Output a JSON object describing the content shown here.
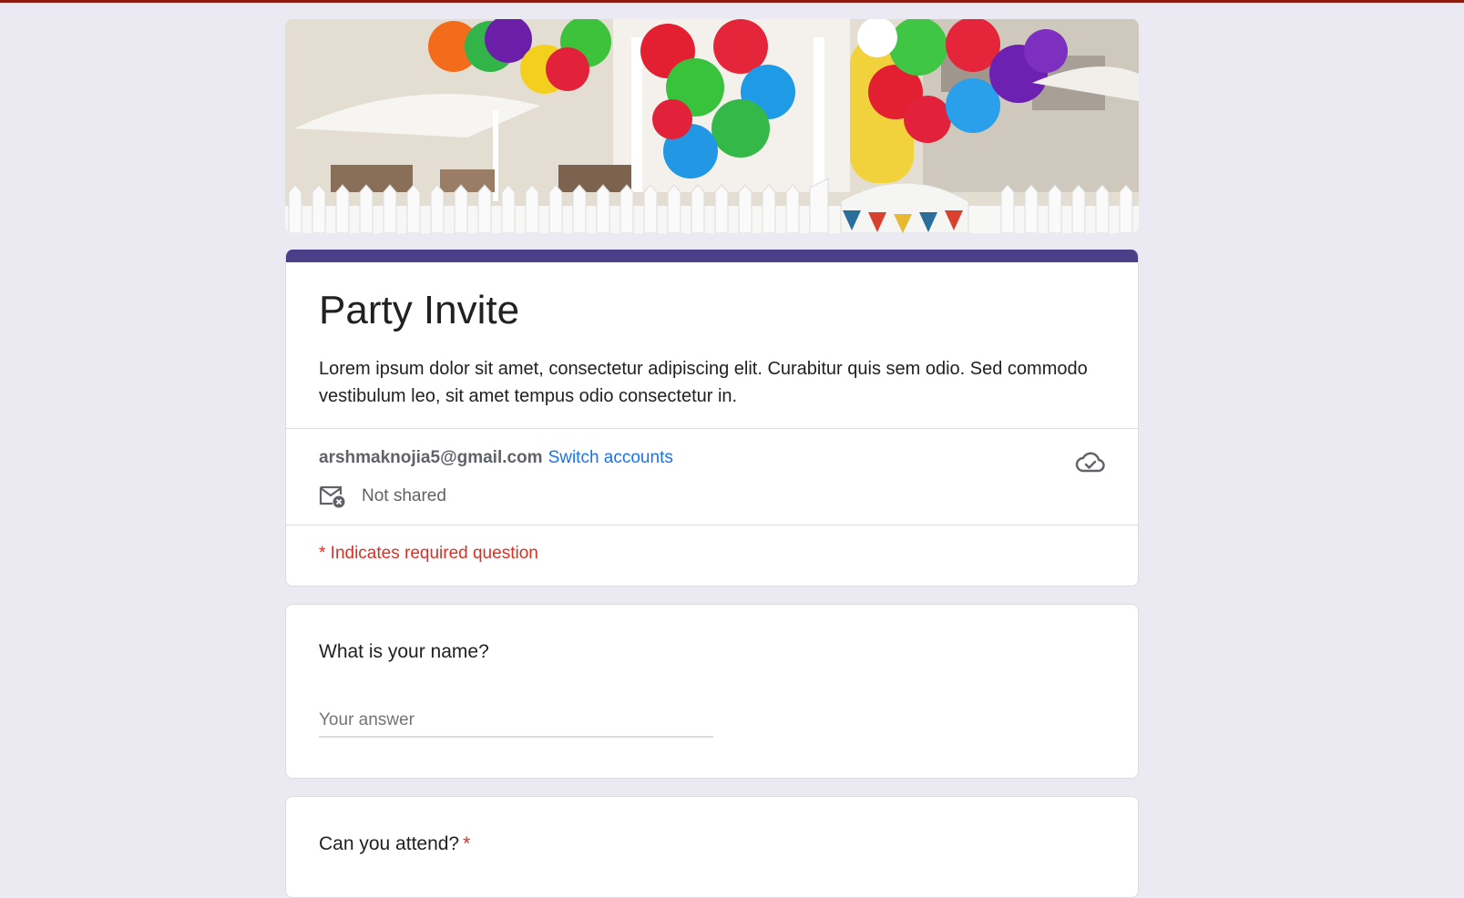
{
  "form": {
    "title": "Party Invite",
    "description": "Lorem ipsum dolor sit amet, consectetur adipiscing elit. Curabitur quis sem odio. Sed commodo vestibulum leo, sit amet tempus odio consectetur in.",
    "accent_color": "#4b3f8a"
  },
  "account": {
    "email": "arshmaknojia5@gmail.com",
    "switch_label": "Switch accounts",
    "sharing_status": "Not shared",
    "sharing_icon": "mail-off-icon",
    "sync_icon": "cloud-done-icon"
  },
  "required_note": "* Indicates required question",
  "questions": [
    {
      "title": "What is your name?",
      "required": false,
      "placeholder": "Your answer"
    },
    {
      "title": "Can you attend?",
      "required": true,
      "required_marker": "*"
    }
  ],
  "colors": {
    "page_background": "#ebe9f1",
    "link": "#1a73e8",
    "required": "#d93025"
  }
}
